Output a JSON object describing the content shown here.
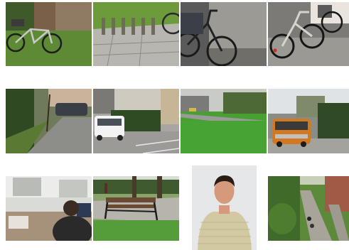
{
  "gallery": {
    "thumbnails": [
      {
        "subject": "bicycle-on-lawn-photo"
      },
      {
        "subject": "bike-rack-photo"
      },
      {
        "subject": "bicycle-against-wall-photo"
      },
      {
        "subject": "bicycle-by-van-photo"
      },
      {
        "subject": "sidewalk-parked-car-photo"
      },
      {
        "subject": "white-car-parking-lot-photo"
      },
      {
        "subject": "green-park-photo"
      },
      {
        "subject": "orange-van-photo"
      },
      {
        "subject": "office-desk-person-photo"
      },
      {
        "subject": "park-bench-photo"
      },
      {
        "subject": "man-portrait-photo"
      },
      {
        "subject": "garden-path-photo"
      }
    ]
  }
}
